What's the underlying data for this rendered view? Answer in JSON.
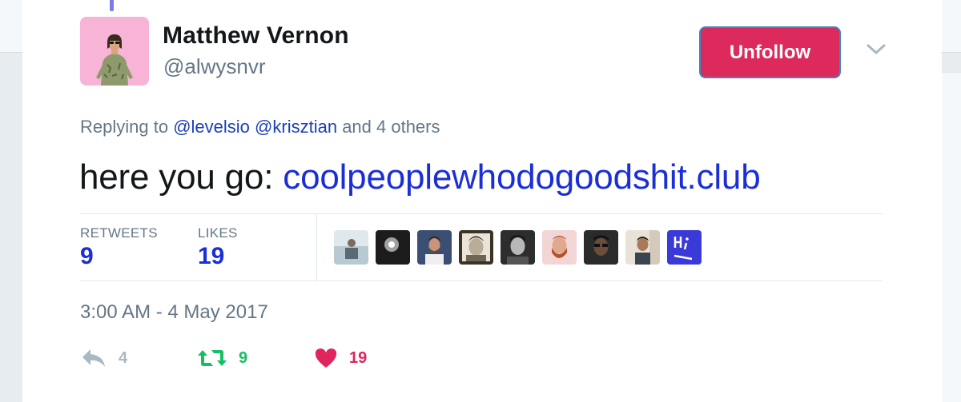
{
  "tweet": {
    "author_name": "Matthew Vernon",
    "author_handle": "@alwysnvr",
    "follow_button_label": "Unfollow",
    "replying_prefix": "Replying to",
    "replying_mentions": [
      "@levelsio",
      "@krisztian"
    ],
    "replying_suffix": "and 4 others",
    "text_prefix": "here you go:",
    "text_link": "coolpeoplewhodogoodshit.club",
    "stats": {
      "retweets_label": "RETWEETS",
      "retweets_value": "9",
      "likes_label": "LIKES",
      "likes_value": "19"
    },
    "timestamp": "3:00 AM - 4 May 2017",
    "actions": {
      "reply_count": "4",
      "retweet_count": "9",
      "like_count": "19"
    }
  },
  "colors": {
    "unfollow_bg": "#dc2a5c",
    "link": "#1b2fd6",
    "retweet_green": "#17bf63",
    "like_red": "#e0245e",
    "muted": "#657786"
  },
  "likers_avatars": [
    "liker-avatar-1",
    "liker-avatar-2",
    "liker-avatar-3",
    "liker-avatar-4",
    "liker-avatar-5",
    "liker-avatar-6",
    "liker-avatar-7",
    "liker-avatar-8",
    "liker-avatar-9"
  ]
}
